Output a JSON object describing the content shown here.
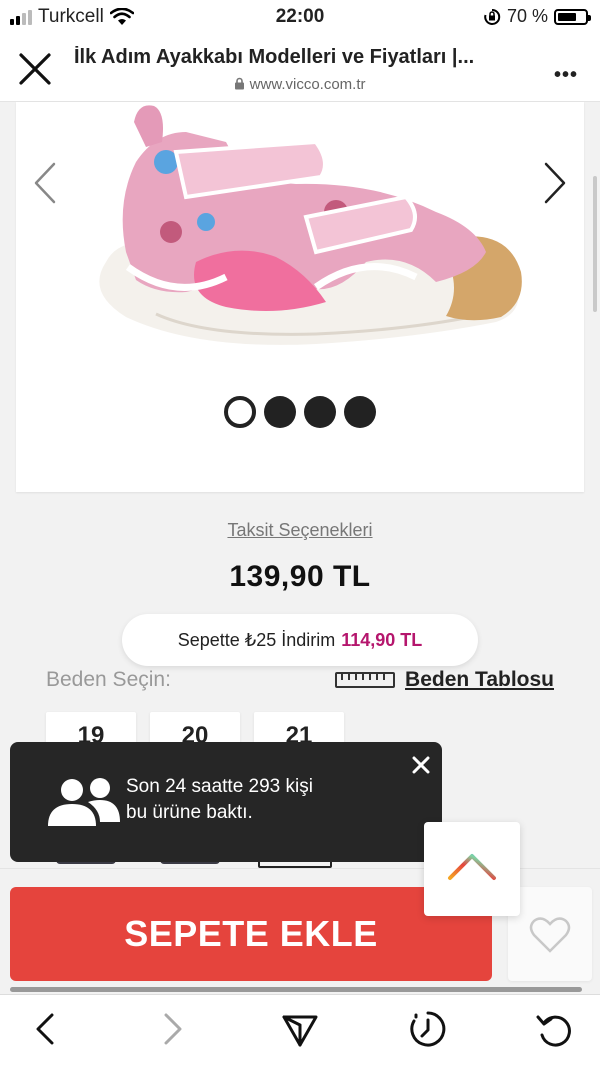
{
  "status_bar": {
    "carrier": "Turkcell",
    "time": "22:00",
    "battery_text": "70 %",
    "battery_level": 0.7
  },
  "browser": {
    "title": "İlk Adım Ayakkabı Modelleri ve Fiyatları |...",
    "url": "www.vicco.com.tr"
  },
  "gallery": {
    "slide_count": 4,
    "active_index": 0
  },
  "product": {
    "taksit_link": "Taksit Seçenekleri",
    "price": "139,90 TL",
    "discount_text": "Sepette ₺25 İndirim",
    "discount_price": "114,90 TL"
  },
  "size_section": {
    "label": "Beden Seçin:",
    "chart_link": "Beden Tablosu",
    "sizes": [
      "19",
      "20",
      "21"
    ]
  },
  "toast": {
    "line1": "Son 24 saatte 293 kişi",
    "line2": "bu ürüne baktı."
  },
  "cart": {
    "add_button": "SEPETE EKLE"
  },
  "colors": {
    "accent_red": "#e5443d",
    "discount_magenta": "#b5166d"
  }
}
